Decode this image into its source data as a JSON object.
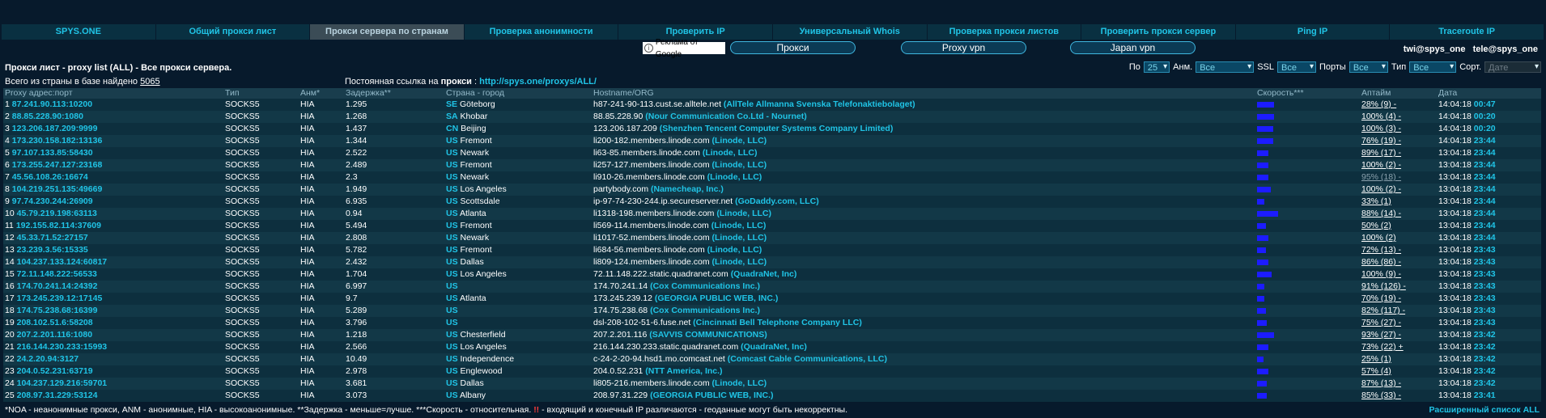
{
  "nav": [
    {
      "label": "SPYS.ONE",
      "active": false
    },
    {
      "label": "Общий прокси лист",
      "active": false
    },
    {
      "label": "Прокси сервера по странам",
      "active": true
    },
    {
      "label": "Проверка анонимности",
      "active": false
    },
    {
      "label": "Проверить IP",
      "active": false
    },
    {
      "label": "Универсальный Whois",
      "active": false
    },
    {
      "label": "Проверка прокси листов",
      "active": false
    },
    {
      "label": "Проверить прокси сервер",
      "active": false
    },
    {
      "label": "Ping IP",
      "active": false
    },
    {
      "label": "Traceroute IP",
      "active": false
    }
  ],
  "ad": {
    "label": "Реклама от Google",
    "pills": [
      "Прокси",
      "Proxy vpn",
      "Japan vpn"
    ]
  },
  "emails": [
    "twi@spys_one",
    "tele@spys_one"
  ],
  "title": "Прокси лист - proxy list (ALL) - Все прокси сервера.",
  "filters": {
    "po_label": "По",
    "po_value": "25",
    "anm_label": "Анм.",
    "anm_value": "Все",
    "ssl_label": "SSL",
    "ssl_value": "Все",
    "ports_label": "Порты",
    "ports_value": "Все",
    "type_label": "Тип",
    "type_value": "Все",
    "sort_label": "Сорт.",
    "sort_value": "Дате"
  },
  "count_text": "Всего из страны в базе найдено",
  "count_value": "5065",
  "permalink_text": "Постоянная ссылка на",
  "permalink_bold": "прокси",
  "permalink_url": "http://spys.one/proxys/ALL/",
  "columns": [
    "Proxy адрес:порт",
    "Тип",
    "Анм*",
    "Задержка**",
    "Страна - город",
    "Hostname/ORG",
    "Скорость***",
    "Аптайм",
    "Дата"
  ],
  "rows": [
    {
      "n": "1",
      "ip": "87.241.90.113:10200",
      "type": "SOCKS5",
      "anm": "HIA",
      "lat": "1.295",
      "cc": "SE",
      "city": "Göteborg",
      "host": "h87-241-90-113.cust.se.alltele.net",
      "org": "(AllTele Allmanna Svenska Telefonaktiebolaget)",
      "speed": 0.7,
      "up": "28% (9) -",
      "date": "14:04:18",
      "time": "00:47"
    },
    {
      "n": "2",
      "ip": "88.85.228.90:1080",
      "type": "SOCKS5",
      "anm": "HIA",
      "lat": "1.268",
      "cc": "SA",
      "city": "Khobar",
      "host": "88.85.228.90",
      "org": "(Nour Communication Co.Ltd - Nournet)",
      "speed": 0.7,
      "up": "100% (4) -",
      "date": "14:04:18",
      "time": "00:20"
    },
    {
      "n": "3",
      "ip": "123.206.187.209:9999",
      "type": "SOCKS5",
      "anm": "HIA",
      "lat": "1.437",
      "cc": "CN",
      "city": "Beijing",
      "host": "123.206.187.209",
      "org": "(Shenzhen Tencent Computer Systems Company Limited)",
      "speed": 0.65,
      "up": "100% (3) -",
      "date": "14:04:18",
      "time": "00:20"
    },
    {
      "n": "4",
      "ip": "173.230.158.182:13136",
      "type": "SOCKS5",
      "anm": "HIA",
      "lat": "1.344",
      "cc": "US",
      "city": "Fremont",
      "host": "li200-182.members.linode.com",
      "org": "(Linode, LLC)",
      "speed": 0.65,
      "up": "76% (19) -",
      "date": "14:04:18",
      "time": "23:44"
    },
    {
      "n": "5",
      "ip": "97.107.133.85:58430",
      "type": "SOCKS5",
      "anm": "HIA",
      "lat": "2.522",
      "cc": "US",
      "city": "Newark",
      "host": "li63-85.members.linode.com",
      "org": "(Linode, LLC)",
      "speed": 0.45,
      "up": "89% (17) -",
      "date": "13:04:18",
      "time": "23:44"
    },
    {
      "n": "6",
      "ip": "173.255.247.127:23168",
      "type": "SOCKS5",
      "anm": "HIA",
      "lat": "2.489",
      "cc": "US",
      "city": "Fremont",
      "host": "li257-127.members.linode.com",
      "org": "(Linode, LLC)",
      "speed": 0.45,
      "up": "100% (2) -",
      "date": "13:04:18",
      "time": "23:44"
    },
    {
      "n": "7",
      "ip": "45.56.108.26:16674",
      "type": "SOCKS5",
      "anm": "HIA",
      "lat": "2.3",
      "cc": "US",
      "city": "Newark",
      "host": "li910-26.members.linode.com",
      "org": "(Linode, LLC)",
      "speed": 0.45,
      "up": "95% (18) -",
      "up_dim": true,
      "date": "13:04:18",
      "time": "23:44"
    },
    {
      "n": "8",
      "ip": "104.219.251.135:49669",
      "type": "SOCKS5",
      "anm": "HIA",
      "lat": "1.949",
      "cc": "US",
      "city": "Los Angeles",
      "host": "partybody.com",
      "org": "(Namecheap, Inc.)",
      "speed": 0.55,
      "up": "100% (2) -",
      "date": "13:04:18",
      "time": "23:44"
    },
    {
      "n": "9",
      "ip": "97.74.230.244:26909",
      "type": "SOCKS5",
      "anm": "HIA",
      "lat": "6.935",
      "cc": "US",
      "city": "Scottsdale",
      "host": "ip-97-74-230-244.ip.secureserver.net",
      "org": "(GoDaddy.com, LLC)",
      "speed": 0.3,
      "up": "33% (1)",
      "date": "13:04:18",
      "time": "23:44"
    },
    {
      "n": "10",
      "ip": "45.79.219.198:63113",
      "type": "SOCKS5",
      "anm": "HIA",
      "lat": "0.94",
      "cc": "US",
      "city": "Atlanta",
      "host": "li1318-198.members.linode.com",
      "org": "(Linode, LLC)",
      "speed": 0.85,
      "up": "88% (14) -",
      "date": "13:04:18",
      "time": "23:44"
    },
    {
      "n": "11",
      "ip": "192.155.82.114:37609",
      "type": "SOCKS5",
      "anm": "HIA",
      "lat": "5.494",
      "cc": "US",
      "city": "Fremont",
      "host": "li569-114.members.linode.com",
      "org": "(Linode, LLC)",
      "speed": 0.35,
      "up": "50% (2)",
      "date": "13:04:18",
      "time": "23:44"
    },
    {
      "n": "12",
      "ip": "45.33.71.52:27157",
      "type": "SOCKS5",
      "anm": "HIA",
      "lat": "2.808",
      "cc": "US",
      "city": "Newark",
      "host": "li1017-52.members.linode.com",
      "org": "(Linode, LLC)",
      "speed": 0.45,
      "up": "100% (2)",
      "date": "13:04:18",
      "time": "23:44"
    },
    {
      "n": "13",
      "ip": "23.239.3.56:15335",
      "type": "SOCKS5",
      "anm": "HIA",
      "lat": "5.782",
      "cc": "US",
      "city": "Fremont",
      "host": "li684-56.members.linode.com",
      "org": "(Linode, LLC)",
      "speed": 0.35,
      "up": "72% (13) -",
      "date": "13:04:18",
      "time": "23:43"
    },
    {
      "n": "14",
      "ip": "104.237.133.124:60817",
      "type": "SOCKS5",
      "anm": "HIA",
      "lat": "2.432",
      "cc": "US",
      "city": "Dallas",
      "host": "li809-124.members.linode.com",
      "org": "(Linode, LLC)",
      "speed": 0.45,
      "up": "86% (86) -",
      "date": "13:04:18",
      "time": "23:43"
    },
    {
      "n": "15",
      "ip": "72.11.148.222:56533",
      "type": "SOCKS5",
      "anm": "HIA",
      "lat": "1.704",
      "cc": "US",
      "city": "Los Angeles",
      "host": "72.11.148.222.static.quadranet.com",
      "org": "(QuadraNet, Inc)",
      "speed": 0.6,
      "up": "100% (9) -",
      "date": "13:04:18",
      "time": "23:43"
    },
    {
      "n": "16",
      "ip": "174.70.241.14:24392",
      "type": "SOCKS5",
      "anm": "HIA",
      "lat": "6.997",
      "cc": "US",
      "city": "",
      "host": "174.70.241.14",
      "org": "(Cox Communications Inc.)",
      "speed": 0.3,
      "up": "91% (126) -",
      "date": "13:04:18",
      "time": "23:43"
    },
    {
      "n": "17",
      "ip": "173.245.239.12:17145",
      "type": "SOCKS5",
      "anm": "HIA",
      "lat": "9.7",
      "cc": "US",
      "city": "Atlanta",
      "host": "173.245.239.12",
      "org": "(GEORGIA PUBLIC WEB, INC.)",
      "speed": 0.3,
      "up": "70% (19) -",
      "date": "13:04:18",
      "time": "23:43"
    },
    {
      "n": "18",
      "ip": "174.75.238.68:16399",
      "type": "SOCKS5",
      "anm": "HIA",
      "lat": "5.289",
      "cc": "US",
      "city": "",
      "host": "174.75.238.68",
      "org": "(Cox Communications Inc.)",
      "speed": 0.35,
      "up": "82% (117) -",
      "date": "13:04:18",
      "time": "23:43"
    },
    {
      "n": "19",
      "ip": "208.102.51.6:58208",
      "type": "SOCKS5",
      "anm": "HIA",
      "lat": "3.796",
      "cc": "US",
      "city": "",
      "host": "dsl-208-102-51-6.fuse.net",
      "org": "(Cincinnati Bell Telephone Company LLC)",
      "speed": 0.4,
      "up": "75% (27) -",
      "date": "13:04:18",
      "time": "23:43"
    },
    {
      "n": "20",
      "ip": "207.2.201.116:1080",
      "type": "SOCKS5",
      "anm": "HIA",
      "lat": "1.218",
      "cc": "US",
      "city": "Chesterfield",
      "host": "207.2.201.116",
      "org": "(SAVVIS COMMUNICATIONS)",
      "speed": 0.7,
      "up": "93% (27) -",
      "date": "13:04:18",
      "time": "23:42"
    },
    {
      "n": "21",
      "ip": "216.144.230.233:15993",
      "type": "SOCKS5",
      "anm": "HIA",
      "lat": "2.566",
      "cc": "US",
      "city": "Los Angeles",
      "host": "216.144.230.233.static.quadranet.com",
      "org": "(QuadraNet, Inc)",
      "speed": 0.45,
      "up": "73% (22) +",
      "date": "13:04:18",
      "time": "23:42"
    },
    {
      "n": "22",
      "ip": "24.2.20.94:3127",
      "type": "SOCKS5",
      "anm": "HIA",
      "lat": "10.49",
      "cc": "US",
      "city": "Independence",
      "host": "c-24-2-20-94.hsd1.mo.comcast.net",
      "org": "(Comcast Cable Communications, LLC)",
      "speed": 0.25,
      "up": "25% (1)",
      "date": "13:04:18",
      "time": "23:42"
    },
    {
      "n": "23",
      "ip": "204.0.52.231:63719",
      "type": "SOCKS5",
      "anm": "HIA",
      "lat": "2.978",
      "cc": "US",
      "city": "Englewood",
      "host": "204.0.52.231",
      "org": "(NTT America, Inc.)",
      "speed": 0.45,
      "up": "57% (4)",
      "date": "13:04:18",
      "time": "23:42"
    },
    {
      "n": "24",
      "ip": "104.237.129.216:59701",
      "type": "SOCKS5",
      "anm": "HIA",
      "lat": "3.681",
      "cc": "US",
      "city": "Dallas",
      "host": "li805-216.members.linode.com",
      "org": "(Linode, LLC)",
      "speed": 0.4,
      "up": "87% (13) -",
      "date": "13:04:18",
      "time": "23:42"
    },
    {
      "n": "25",
      "ip": "208.97.31.229:53124",
      "type": "SOCKS5",
      "anm": "HIA",
      "lat": "3.073",
      "cc": "US",
      "city": "Albany",
      "host": "208.97.31.229",
      "org": "(GEORGIA PUBLIC WEB, INC.)",
      "speed": 0.4,
      "up": "85% (33) -",
      "date": "13:04:18",
      "time": "23:41"
    }
  ],
  "footer_note_a": "*NOA - неанонимные прокси, ANM - анонимные, HIA - высокоанонимные. **Задержка - меньше=лучше. ***Скорость - относительная.",
  "footer_warn": "!!",
  "footer_note_b": "- входящий и конечный IP различаются - геоданные могут быть некорректны.",
  "footer_ext": "Расширенный список ALL",
  "colors": {
    "accent": "#20c4e6",
    "bg": "#071a2c",
    "bar": "#1c1cff"
  }
}
